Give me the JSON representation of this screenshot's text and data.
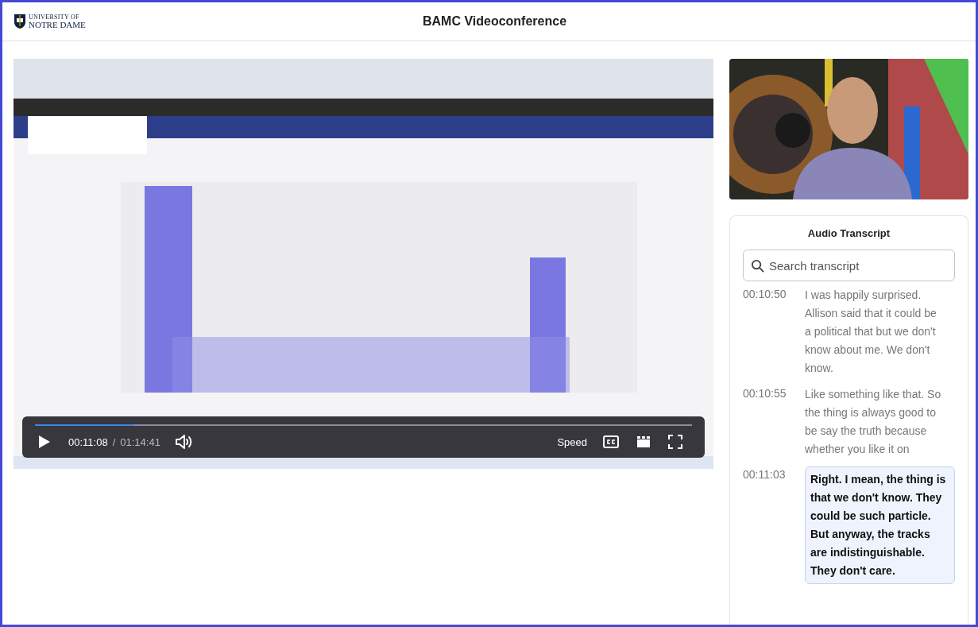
{
  "header": {
    "logo_line1": "UNIVERSITY OF",
    "logo_line2": "NOTRE DAME",
    "title": "BAMC Videoconference"
  },
  "player": {
    "kind": "picture",
    "playing": false,
    "current_time": "00:11:08",
    "separator": "/",
    "duration": "01:14:41",
    "level": 0.15,
    "speed_label": "Speed"
  },
  "transcript": {
    "title": "Audio Transcript",
    "search": {
      "placeholder": "Search transcript"
    },
    "entries": [
      {
        "time": "00:10:50",
        "text": "I was happily surprised. Allison said that it could be a political that but we don't know about me. We don't know.",
        "selected": false
      },
      {
        "time": "00:10:55",
        "text": "Like something like that. So the thing is always good to be say the truth because whether you like it on",
        "selected": false
      },
      {
        "time": "00:11:03",
        "text": "Right. I mean, the thing is that we don't know. They could be such particle. But anyway, the tracks are indistinguishable. They don't care.",
        "selected": true
      }
    ]
  }
}
